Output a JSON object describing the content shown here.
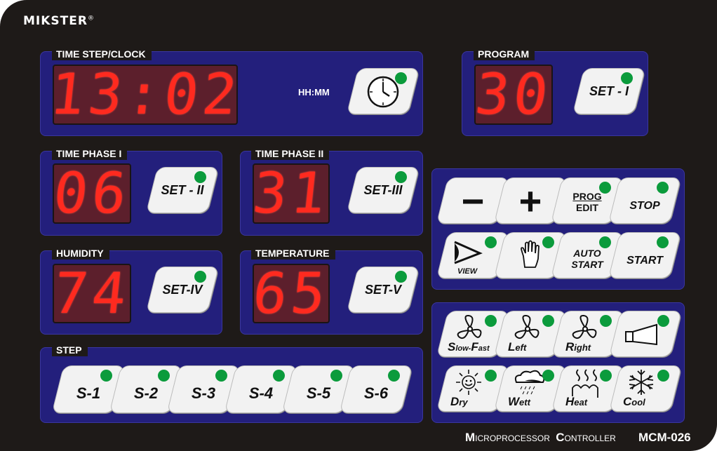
{
  "brand": {
    "logo": "MIKSTER",
    "reg": "®"
  },
  "colors": {
    "panel": "#231f7c",
    "display": "#5c1f2c",
    "digit": "#ff2a1f",
    "led": "#0b9b3c",
    "body": "#1e1a18"
  },
  "time_step": {
    "label": "TIME STEP/CLOCK",
    "value": "13:02",
    "unit": "HH:MM",
    "button_icon": "clock-icon"
  },
  "program": {
    "label": "PROGRAM",
    "value": "30",
    "button": "SET - I"
  },
  "time_phase_1": {
    "label": "TIME PHASE I",
    "value": "06",
    "button": "SET - II"
  },
  "time_phase_2": {
    "label": "TIME PHASE II",
    "value": "31",
    "button": "SET-III"
  },
  "humidity": {
    "label": "HUMIDITY",
    "value": "74",
    "button": "SET-IV"
  },
  "temperature": {
    "label": "TEMPERATURE",
    "value": "65",
    "button": "SET-V"
  },
  "step": {
    "label": "STEP",
    "buttons": [
      "S-1",
      "S-2",
      "S-3",
      "S-4",
      "S-5",
      "S-6"
    ]
  },
  "controls": {
    "minus": "−",
    "plus": "+",
    "prog": "PROG",
    "edit": "EDIT",
    "stop": "STOP",
    "view": "VIEW",
    "hand_icon": "hand-icon",
    "auto": "AUTO",
    "start_l": "START",
    "start": "START"
  },
  "functions": {
    "slow_fast": {
      "a": "S",
      "b": "low-",
      "c": "F",
      "d": "ast"
    },
    "left": {
      "a": "L",
      "b": "eft"
    },
    "right": {
      "a": "R",
      "b": "ight"
    },
    "horn_icon": "horn-icon",
    "dry": {
      "a": "D",
      "b": "ry"
    },
    "wett": {
      "a": "W",
      "b": "ett"
    },
    "heat": {
      "a": "H",
      "b": "eat"
    },
    "cool": {
      "a": "C",
      "b": "ool"
    }
  },
  "footer": {
    "m": "M",
    "icro": "ICROPROCESSOR",
    "c": "C",
    "ontroller": "ONTROLLER",
    "model": "MCM-026"
  }
}
